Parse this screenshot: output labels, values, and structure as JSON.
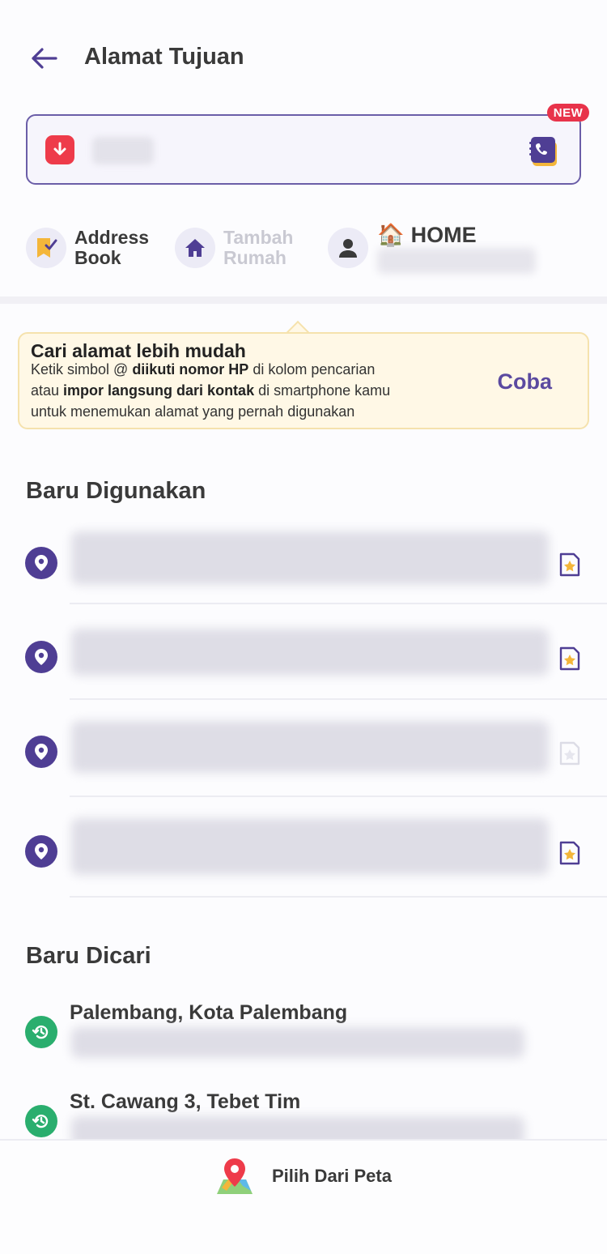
{
  "header": {
    "title": "Alamat Tujuan"
  },
  "search": {
    "value": "",
    "placeholder": "",
    "badge": "NEW"
  },
  "shortcuts": {
    "address_book": {
      "line1": "Address",
      "line2": "Book"
    },
    "add_home": {
      "line1": "Tambah",
      "line2": "Rumah"
    },
    "home": {
      "emoji": "🏠",
      "label": "HOME"
    }
  },
  "tip": {
    "title": "Cari alamat lebih mudah",
    "line1_pre": "Ketik simbol @ ",
    "line1_bold": "diikuti nomor HP",
    "line1_post": " di kolom pencarian",
    "line2_pre": "atau ",
    "line2_bold": "impor langsung dari kontak",
    "line2_post": " di smartphone kamu",
    "line3": "untuk menemukan alamat yang pernah digunakan",
    "cta": "Coba"
  },
  "recent_used": {
    "title": "Baru Digunakan",
    "items": [
      {
        "bookmarked": true
      },
      {
        "bookmarked": true
      },
      {
        "bookmarked": false
      },
      {
        "bookmarked": true
      }
    ]
  },
  "recent_search": {
    "title": "Baru Dicari",
    "items": [
      {
        "title": "Palembang, Kota Palembang"
      },
      {
        "title": "St. Cawang 3, Tebet Tim"
      }
    ]
  },
  "bottom": {
    "map_label": "Pilih Dari Peta"
  },
  "colors": {
    "primary": "#5b4aa0",
    "pin": "#4f3e94",
    "history": "#2aae6e",
    "alert": "#e8334a",
    "tip_bg": "#fff8e6"
  }
}
